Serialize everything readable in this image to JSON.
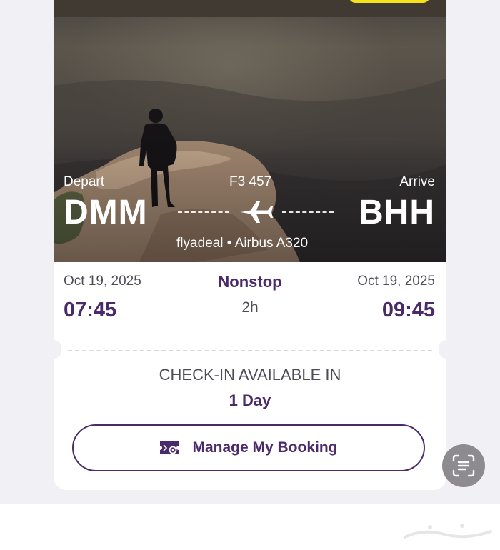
{
  "flight": {
    "depart_label": "Depart",
    "arrive_label": "Arrive",
    "flight_number": "F3 457",
    "from_code": "DMM",
    "to_code": "BHH",
    "aircraft_info": "flyadeal • Airbus A320",
    "depart_date": "Oct 19, 2025",
    "arrive_date": "Oct 19, 2025",
    "depart_time": "07:45",
    "arrive_time": "09:45",
    "stops": "Nonstop",
    "duration": "2h"
  },
  "checkin": {
    "title": "CHECK-IN AVAILABLE IN",
    "value": "1 Day"
  },
  "actions": {
    "manage_booking_label": "Manage My Booking",
    "manage_booking_icon": "ticket-settings-icon",
    "scan_fab_icon": "screen-scan-icon"
  },
  "colors": {
    "brand_purple": "#4b2a6a",
    "accent_yellow": "#f6e21b",
    "text_gray": "#4e4b57"
  }
}
